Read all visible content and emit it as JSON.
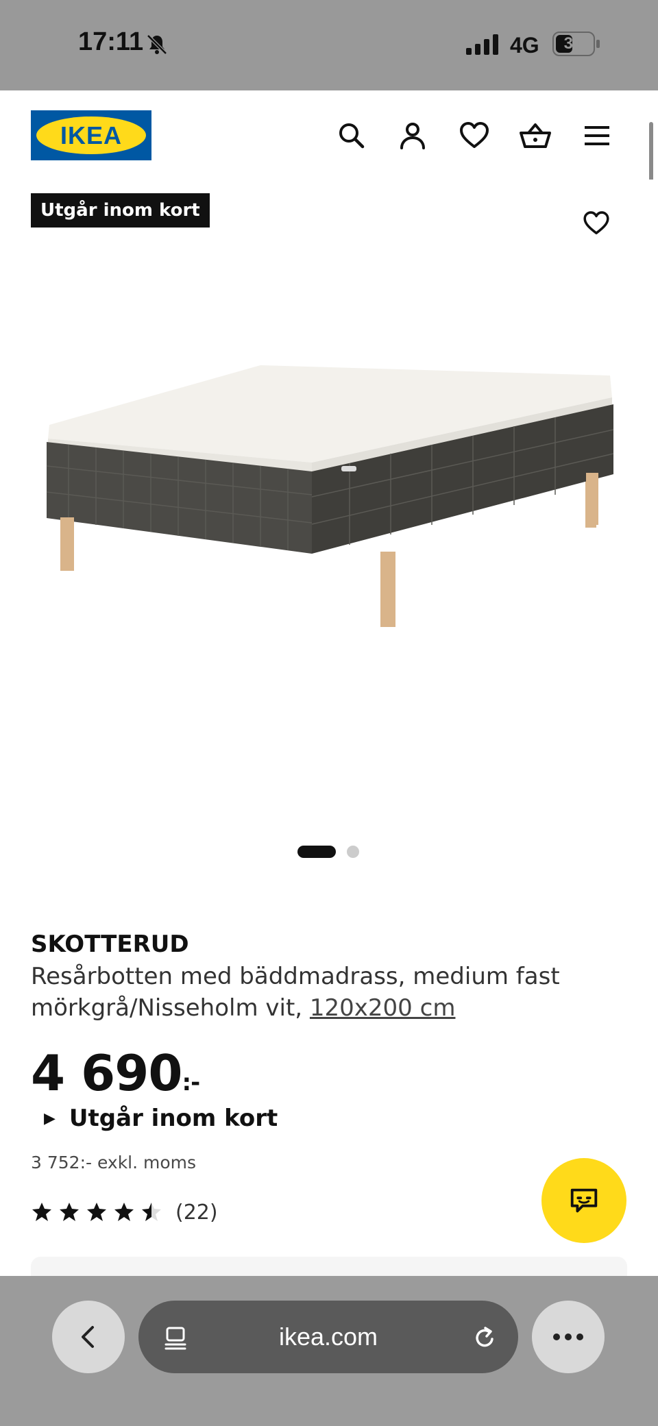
{
  "status_bar": {
    "time": "17:11",
    "network": "4G",
    "battery": "34"
  },
  "header": {
    "logo_text": "IKEA",
    "icons": [
      "search-icon",
      "account-icon",
      "heart-icon",
      "basket-icon",
      "menu-icon"
    ]
  },
  "product": {
    "badge": "Utgår inom kort",
    "brand": "SKOTTERUD",
    "description_line1": "Resårbotten med bäddmadrass, medium fast",
    "description_line2": "mörkgrå/Nisseholm vit, ",
    "size_link": "120x200 cm",
    "price_main": "4 690",
    "price_suffix": ":-",
    "availability": "Utgår inom kort",
    "price_excl": "3 752:- exkl. moms",
    "rating": 4.5,
    "review_count": "(22)"
  },
  "carousel": {
    "current": 1,
    "total": 2
  },
  "browser": {
    "url": "ikea.com"
  },
  "colors": {
    "ikea_blue": "#0058a3",
    "ikea_yellow": "#ffda1a",
    "status_gray": "#999999"
  }
}
